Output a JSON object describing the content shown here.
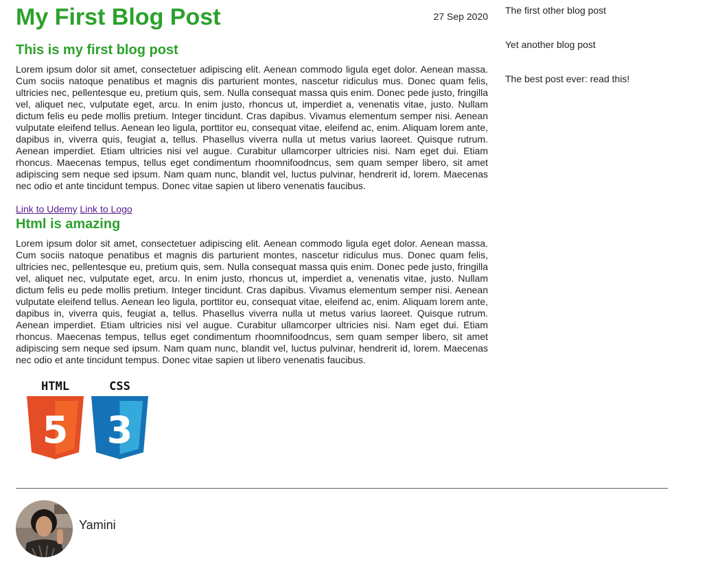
{
  "post": {
    "title": "My First Blog Post",
    "date": "27 Sep 2020",
    "sections": [
      {
        "heading": "This is my first blog post",
        "body": "Lorem ipsum dolor sit amet, consectetuer adipiscing elit. Aenean commodo ligula eget dolor. Aenean massa. Cum sociis natoque penatibus et magnis dis parturient montes, nascetur ridiculus mus. Donec quam felis, ultricies nec, pellentesque eu, pretium quis, sem. Nulla consequat massa quis enim. Donec pede justo, fringilla vel, aliquet nec, vulputate eget, arcu. In enim justo, rhoncus ut, imperdiet a, venenatis vitae, justo. Nullam dictum felis eu pede mollis pretium. Integer tincidunt. Cras dapibus. Vivamus elementum semper nisi. Aenean vulputate eleifend tellus. Aenean leo ligula, porttitor eu, consequat vitae, eleifend ac, enim. Aliquam lorem ante, dapibus in, viverra quis, feugiat a, tellus. Phasellus viverra nulla ut metus varius laoreet. Quisque rutrum. Aenean imperdiet. Etiam ultricies nisi vel augue. Curabitur ullamcorper ultricies nisi. Nam eget dui. Etiam rhoncus. Maecenas tempus, tellus eget condimentum rhoomnifoodncus, sem quam semper libero, sit amet adipiscing sem neque sed ipsum. Nam quam nunc, blandit vel, luctus pulvinar, hendrerit id, lorem. Maecenas nec odio et ante tincidunt tempus. Donec vitae sapien ut libero venenatis faucibus."
      },
      {
        "heading": "Html is amazing",
        "body": "Lorem ipsum dolor sit amet, consectetuer adipiscing elit. Aenean commodo ligula eget dolor. Aenean massa. Cum sociis natoque penatibus et magnis dis parturient montes, nascetur ridiculus mus. Donec quam felis, ultricies nec, pellentesque eu, pretium quis, sem. Nulla consequat massa quis enim. Donec pede justo, fringilla vel, aliquet nec, vulputate eget, arcu. In enim justo, rhoncus ut, imperdiet a, venenatis vitae, justo. Nullam dictum felis eu pede mollis pretium. Integer tincidunt. Cras dapibus. Vivamus elementum semper nisi. Aenean vulputate eleifend tellus. Aenean leo ligula, porttitor eu, consequat vitae, eleifend ac, enim. Aliquam lorem ante, dapibus in, viverra quis, feugiat a, tellus. Phasellus viverra nulla ut metus varius laoreet. Quisque rutrum. Aenean imperdiet. Etiam ultricies nisi vel augue. Curabitur ullamcorper ultricies nisi. Nam eget dui. Etiam rhoncus. Maecenas tempus, tellus eget condimentum rhoomnifoodncus, sem quam semper libero, sit amet adipiscing sem neque sed ipsum. Nam quam nunc, blandit vel, luctus pulvinar, hendrerit id, lorem. Maecenas nec odio et ante tincidunt tempus. Donec vitae sapien ut libero venenatis faucibus."
      }
    ],
    "links": [
      {
        "label": "Link to Udemy"
      },
      {
        "label": "Link to Logo"
      }
    ],
    "logos": {
      "html_label": "HTML",
      "html_number": "5",
      "css_label": "CSS",
      "css_number": "3",
      "html_color": "#e44d26",
      "html_color_light": "#f16529",
      "css_color": "#1572b6",
      "css_color_light": "#33a9dc",
      "html_icon": "html5-logo-icon",
      "css_icon": "css3-logo-icon"
    }
  },
  "sidebar": {
    "items": [
      {
        "label": "The first other blog post"
      },
      {
        "label": "Yet another blog post"
      },
      {
        "label": "The best post ever: read this!"
      }
    ]
  },
  "author": {
    "name": "Yamini",
    "avatar_icon": "author-avatar-photo"
  },
  "colors": {
    "heading": "#2ca12c",
    "text": "#222222",
    "visited_link": "#551a8b",
    "divider": "#5f5f5f"
  }
}
